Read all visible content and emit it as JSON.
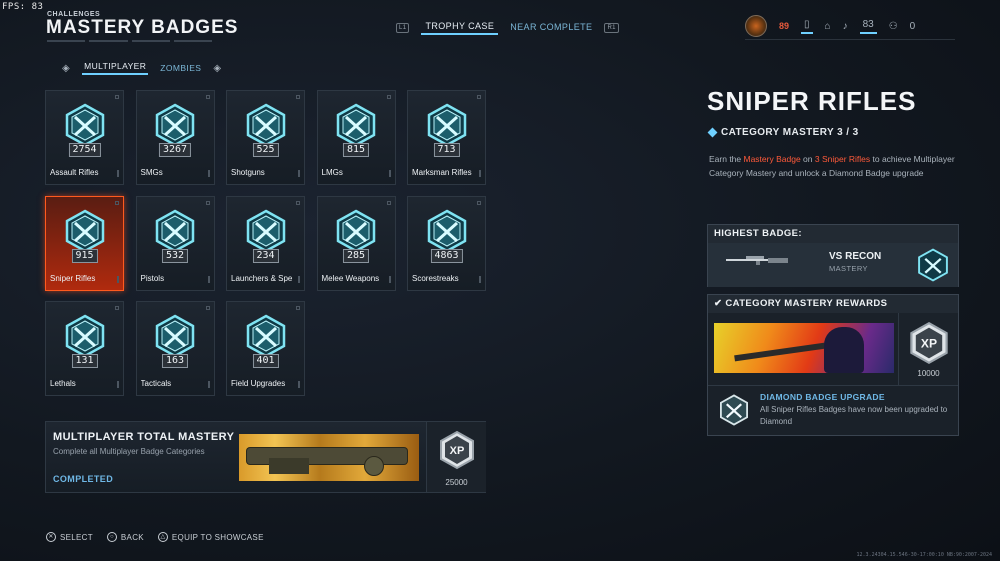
{
  "fps": "FPS:  83",
  "header": {
    "breadcrumb": "CHALLENGES",
    "title": "MASTERY BADGES"
  },
  "top_tabs": [
    {
      "key": "L1",
      "label": "TROPHY CASE",
      "active": true
    },
    {
      "label": "NEAR COMPLETE",
      "key": "R1",
      "active": false
    }
  ],
  "status_bar": {
    "level": "89",
    "prestige": "83",
    "party_count": "0"
  },
  "sub_tabs": [
    {
      "label": "MULTIPLAYER",
      "active": true
    },
    {
      "label": "ZOMBIES",
      "active": false
    }
  ],
  "badges": [
    {
      "label": "Assault Rifles",
      "count": "2754"
    },
    {
      "label": "SMGs",
      "count": "3267"
    },
    {
      "label": "Shotguns",
      "count": "525"
    },
    {
      "label": "LMGs",
      "count": "815"
    },
    {
      "label": "Marksman Rifles",
      "count": "713"
    },
    {
      "label": "Sniper Rifles",
      "count": "915",
      "selected": true
    },
    {
      "label": "Pistols",
      "count": "532"
    },
    {
      "label": "Launchers & Spe",
      "count": "234"
    },
    {
      "label": "Melee Weapons",
      "count": "285"
    },
    {
      "label": "Scorestreaks",
      "count": "4863"
    },
    {
      "label": "Lethals",
      "count": "131"
    },
    {
      "label": "Tacticals",
      "count": "163"
    },
    {
      "label": "Field Upgrades",
      "count": "401"
    }
  ],
  "mastery_card": {
    "title": "MULTIPLAYER TOTAL MASTERY",
    "description": "Complete all Multiplayer Badge Categories",
    "status": "COMPLETED",
    "xp_label": "XP",
    "xp_value": "25000"
  },
  "detail": {
    "title": "SNIPER RIFLES",
    "subtitle": "CATEGORY MASTERY 3 / 3",
    "desc_parts": [
      "Earn the ",
      "Mastery Badge",
      " on ",
      "3 Sniper Rifles",
      " to achieve Multiplayer Category Mastery and unlock a Diamond Badge upgrade"
    ],
    "highest_badge": {
      "heading": "HIGHEST BADGE:",
      "weapon": "VS RECON",
      "tier": "MASTERY"
    },
    "rewards": {
      "heading": "CATEGORY MASTERY REWARDS",
      "xp_label": "XP",
      "xp_value": "10000",
      "upgrade_title": "DIAMOND BADGE UPGRADE",
      "upgrade_desc": "All Sniper Rifles Badges have now been upgraded to Diamond"
    }
  },
  "footer": [
    {
      "glyph": "✕",
      "label": "SELECT"
    },
    {
      "glyph": "○",
      "label": "BACK"
    },
    {
      "glyph": "△",
      "label": "EQUIP TO SHOWCASE"
    }
  ],
  "build": "12.3.24304.15.546-30-17:00:10 NB:90:2007-2024"
}
